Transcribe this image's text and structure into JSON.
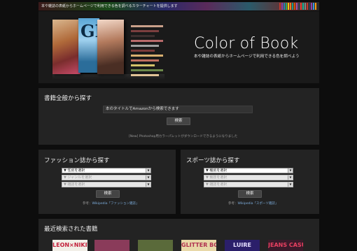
{
  "topbar": {
    "text": "本や雑誌の表紙からホームページで利用できる色を調べるカラーチャートを提供します"
  },
  "hero": {
    "logo": "Color of Book",
    "tagline": "本や雑誌の表紙からホームページで利用できる色を調べよう",
    "swatch_colors": [
      "#c9a08a",
      "#7b3f3f",
      "#3d2f2f",
      "#b86a6a",
      "#a0a0a0",
      "#7a3a3a",
      "#d9b070",
      "#c07060",
      "#d4c36a",
      "#6d8a4a",
      "#e0c090"
    ]
  },
  "general_search": {
    "title": "書籍全般から探す",
    "input_value": "本のタイトルでAmazonから検索できます",
    "button": "検索",
    "note": "[New] Photoshop用カラーパレットがダウンロードできるようになりました"
  },
  "fashion_search": {
    "title": "ファッション誌から探す",
    "selects": [
      "▼ 性別を選択",
      "▼ ジャンルを選択",
      "▼ 雑誌を選択"
    ],
    "button": "検索",
    "ref_prefix": "参考：",
    "ref_link": "Wikipedia「ファッション雑誌」"
  },
  "sports_search": {
    "title": "スポーツ誌から探す",
    "selects": [
      "▼ 種別を選択",
      "▼ 競技を選択",
      "▼ 雑誌を選択"
    ],
    "button": "検索",
    "ref_prefix": "参考：",
    "ref_link": "Wikipedia「スポーツ雑誌」"
  },
  "recent": {
    "title": "最近検索された書籍",
    "items": [
      {
        "label": "LEON×NIKITA",
        "bg": "#f2efe8",
        "fg": "#c21f3a"
      },
      {
        "label": "",
        "bg": "#8a3b5a",
        "fg": "#ffffff"
      },
      {
        "label": "",
        "bg": "#5a6a3a",
        "fg": "#ffffff"
      },
      {
        "label": "GLITTER BOOK",
        "bg": "#e8d8a8",
        "fg": "#b03050"
      },
      {
        "label": "LUIRE",
        "bg": "#2b1f6a",
        "fg": "#e6e0ff"
      },
      {
        "label": "JEANS CASUAL",
        "bg": "#3a1a2a",
        "fg": "#e84060"
      }
    ]
  }
}
